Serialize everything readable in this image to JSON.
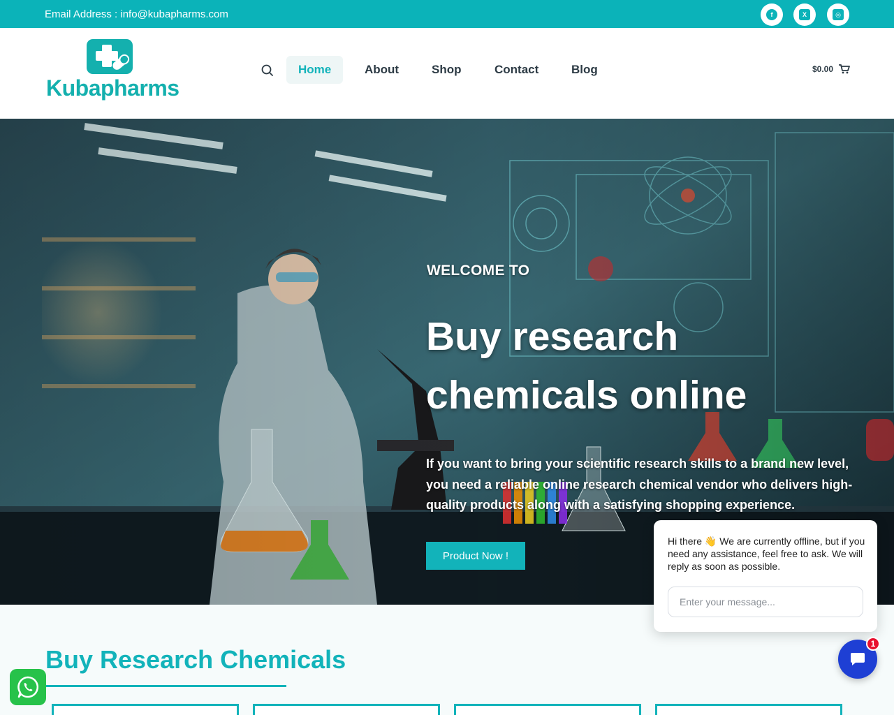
{
  "topbar": {
    "email_text": "Email Address : info@kubapharms.com",
    "social": [
      {
        "icon": "facebook-icon",
        "glyph": "f"
      },
      {
        "icon": "x-twitter-icon",
        "glyph": "X"
      },
      {
        "icon": "instagram-icon",
        "glyph": "◎"
      }
    ]
  },
  "brand": {
    "name": "Kubapharms",
    "accent_color": "#12b3ba",
    "logo_color": "#14b0ae"
  },
  "nav": {
    "items": [
      {
        "label": "Home",
        "active": true
      },
      {
        "label": "About",
        "active": false
      },
      {
        "label": "Shop",
        "active": false
      },
      {
        "label": "Contact",
        "active": false
      },
      {
        "label": "Blog",
        "active": false
      }
    ],
    "cart_total": "$0.00"
  },
  "hero": {
    "kicker": "WELCOME TO",
    "headline": "Buy research chemicals online",
    "description": "If you want to bring your scientific research skills to a brand new level, you need a reliable online research chemical vendor who delivers high-quality products along with a satisfying shopping experience.",
    "cta_label": "Product Now !"
  },
  "section": {
    "title": "Buy Research Chemicals"
  },
  "chat": {
    "message_before": "Hi there",
    "emoji": "👋",
    "message_after": " We are currently offline, but if you need any assistance, feel free to ask. We will reply as soon as possible.",
    "input_placeholder": "Enter your message...",
    "unread_count": "1",
    "launcher_color": "#1e3fd4",
    "badge_color": "#e8102e"
  },
  "whatsapp": {
    "icon": "whatsapp-icon",
    "color": "#27c24a"
  }
}
